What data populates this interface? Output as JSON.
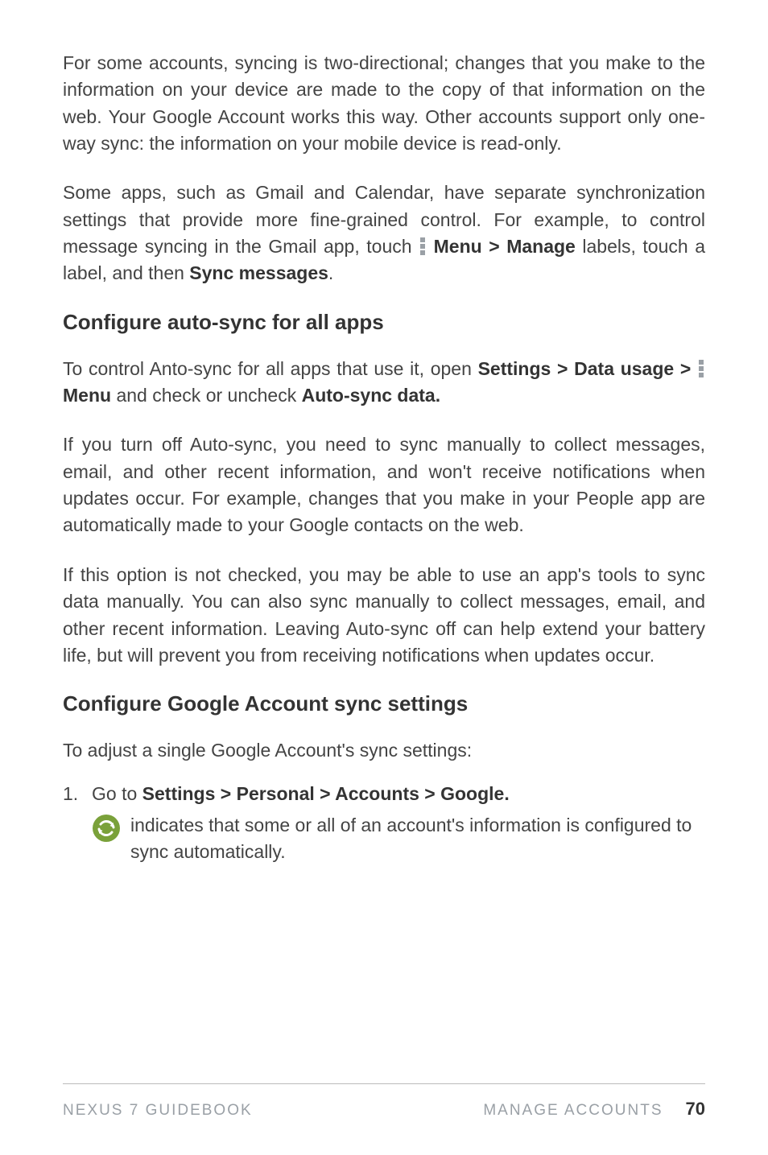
{
  "para1_a": "For some accounts, syncing is two-directional; changes that you make to the information on your device are made to the copy of that information on the web. Your Google Account works this way. Other accounts support only one-way sync: the information on your mobile device is read-only.",
  "para2_a": "Some apps, such as Gmail and Calendar, have separate synchronization settings that provide more fine-grained control. For example, to control message syncing in the Gmail app, touch ",
  "para2_b1": "Menu > Manage",
  "para2_c": " labels, touch a label, and then ",
  "para2_b2": "Sync messages",
  "para2_d": ".",
  "h2_1": "Configure auto-sync for all apps",
  "p3_a": "To control Anto-sync for all apps that use it, open ",
  "p3_b1": "Settings > Data usage > ",
  "p3_b2": " Menu",
  "p3_c": " and check or uncheck ",
  "p3_b3": "Auto-sync data.",
  "p4": "If you turn off Auto-sync, you need to sync manually to collect messages, email, and other recent information, and won't receive notifications when updates occur. For example, changes that you make in your People app are automatically made to your Google contacts on the web.",
  "p5": "If this option is not checked, you may be able to use an app's tools to sync data manually. You can also sync manually to collect messages, email, and other recent information. Leaving Auto-sync off can help extend your battery life, but will prevent you from receiving notifications when updates occur.",
  "h2_2": "Configure Google Account sync settings",
  "p6": "To adjust a single Google Account's sync settings:",
  "step1_a": "Go to ",
  "step1_b": "Settings > Personal > Accounts > Google.",
  "sync_text": " indicates that some or all of an account's information is configured to sync automatically.",
  "footer_left": "NEXUS 7 GUIDEBOOK",
  "footer_mid": "MANAGE ACCOUNTS",
  "footer_page": "70"
}
